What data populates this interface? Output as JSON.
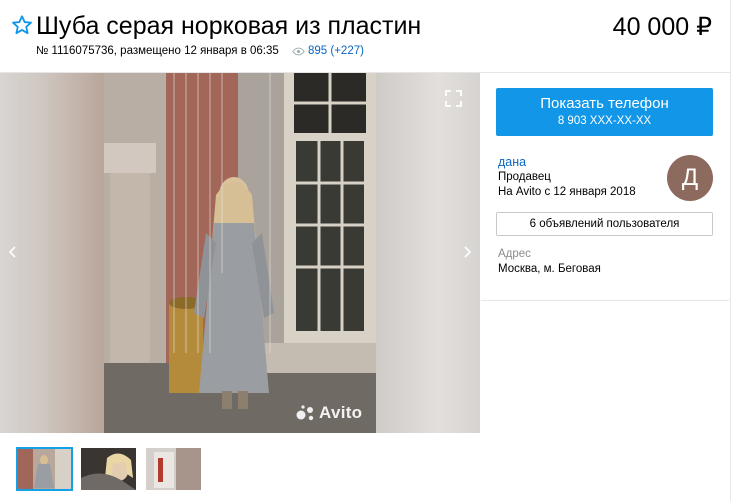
{
  "listing": {
    "title": "Шуба серая норковая из пластин",
    "price": "40 000 ₽",
    "meta": "№ 1116075736, размещено 12 января в 06:35",
    "views": "895 (+227)"
  },
  "gallery": {
    "watermark": "Avito",
    "thumbnail_count": 3,
    "selected_thumbnail": 1
  },
  "seller": {
    "phone_button_label": "Показать телефон",
    "phone_masked": "8 903 XXX-XX-XX",
    "name": "дана",
    "role": "Продавец",
    "since": "На Avito с 12 января 2018",
    "avatar_letter": "Д",
    "ads_button": "6 объявлений пользователя",
    "address_label": "Адрес",
    "address": "Москва, м. Беговая"
  },
  "colors": {
    "accent": "#1296e8",
    "link": "#0a66c2",
    "avatar": "#8c6a5e"
  },
  "icons": [
    "star-icon",
    "eye-icon",
    "expand-icon",
    "chevron-left-icon",
    "chevron-right-icon",
    "avito-logo-icon"
  ]
}
